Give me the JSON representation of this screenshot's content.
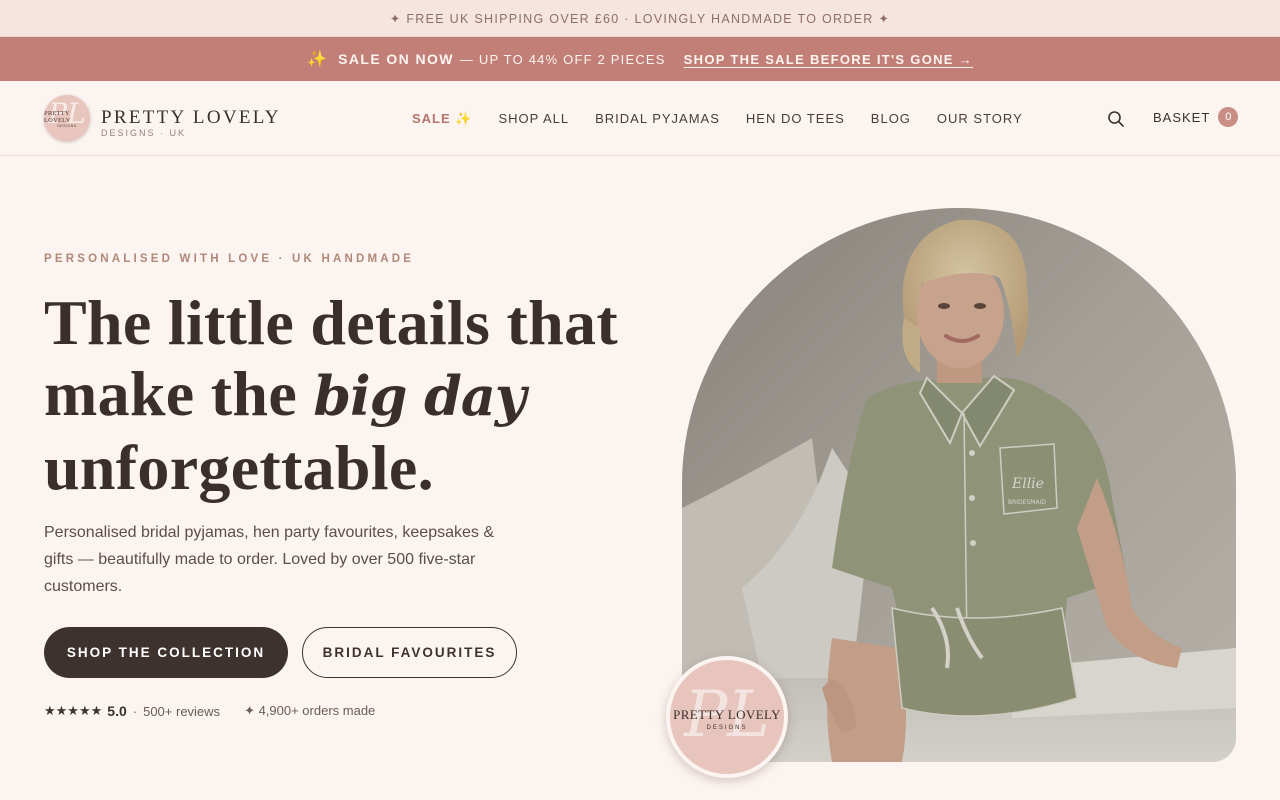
{
  "topbar": {
    "text": "✦ FREE UK SHIPPING OVER £60 · LOVINGLY HANDMADE TO ORDER ✦"
  },
  "salebar": {
    "sparkle": "✨",
    "headline": "SALE ON NOW",
    "subtext": "— UP TO 44% OFF 2 PIECES",
    "link": "SHOP THE SALE BEFORE IT'S GONE →"
  },
  "header": {
    "logo_monogram": "PL",
    "logo_badge_line1": "PRETTY LOVELY",
    "logo_badge_line2": "DESIGNS",
    "brand_name": "PRETTY LOVELY",
    "brand_sub": "DESIGNS · UK",
    "nav": [
      {
        "label": "SALE",
        "badge": "✨"
      },
      {
        "label": "SHOP ALL"
      },
      {
        "label": "BRIDAL PYJAMAS"
      },
      {
        "label": "HEN DO TEES"
      },
      {
        "label": "BLOG"
      },
      {
        "label": "OUR STORY"
      }
    ],
    "search_icon": "search-icon",
    "basket_label": "BASKET",
    "basket_count": "0"
  },
  "hero": {
    "eyebrow": "PERSONALISED WITH LOVE · UK HANDMADE",
    "headline_part1": "The little details that make the ",
    "headline_italic": "big day",
    "headline_part2": " unforgettable.",
    "lede": "Personalised bridal pyjamas, hen party favourites, keepsakes & gifts — beautifully made to order. Loved by over 500 five-star customers.",
    "primary_cta": "SHOP THE COLLECTION",
    "secondary_cta": "BRIDAL FAVOURITES",
    "stars": "★★★★★",
    "rating": "5.0",
    "reviews": "500+ reviews",
    "orders": "✦ 4,900+ orders made",
    "badge_monogram": "PL",
    "badge_line1": "PRETTY LOVELY",
    "badge_line2": "DESIGNS",
    "pocket_script": "Ellie",
    "pocket_text": "BRIDESMAID"
  },
  "colors": {
    "background": "#fbf4f1",
    "sale_bar": "#c27f78",
    "accent": "#b4766c",
    "dark": "#3d322e"
  }
}
